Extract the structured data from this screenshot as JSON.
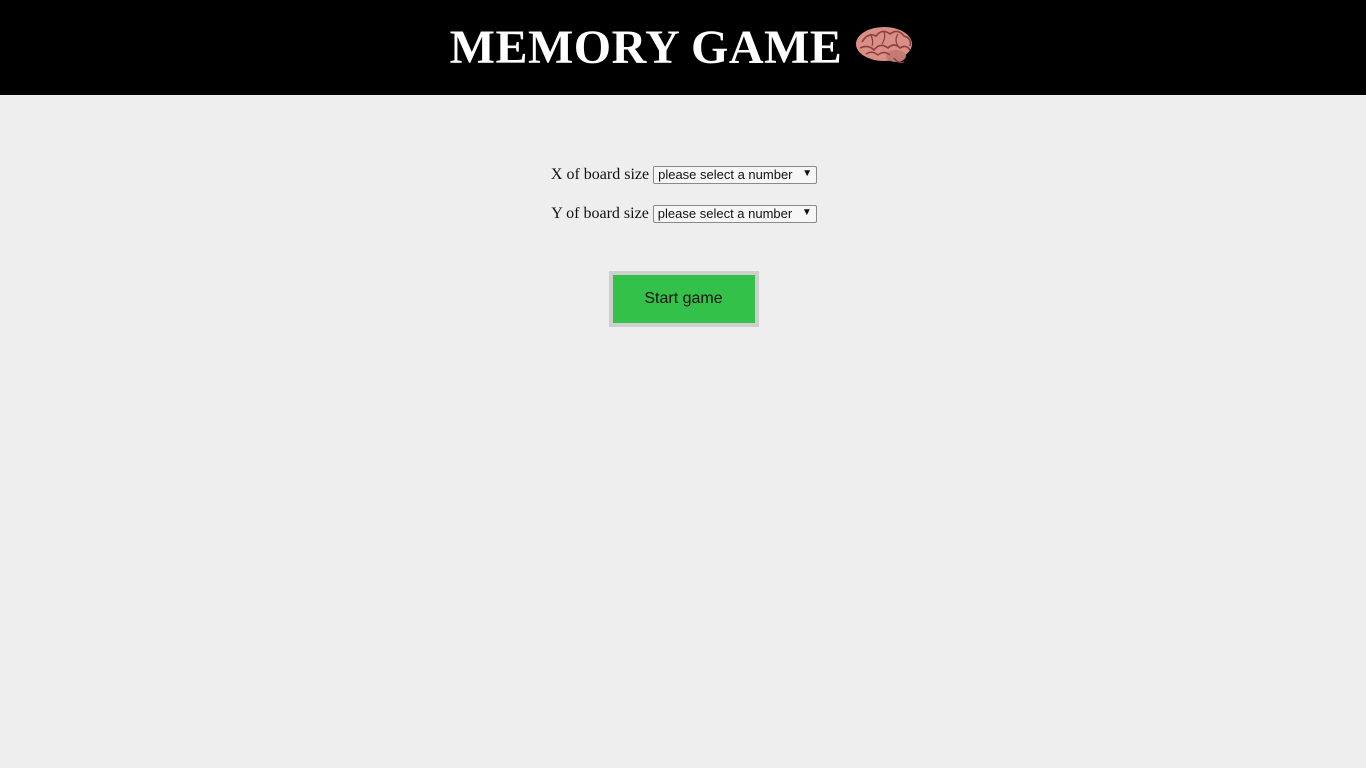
{
  "header": {
    "title": "MEMORY GAME",
    "icon": "brain-icon"
  },
  "form": {
    "x_field": {
      "label": "X of board size",
      "selected": "please select a number"
    },
    "y_field": {
      "label": "Y of board size",
      "selected": "please select a number"
    }
  },
  "actions": {
    "start_label": "Start game"
  },
  "colors": {
    "header_bg": "#000000",
    "page_bg": "#eeeeee",
    "button_bg": "#33c14a",
    "button_border": "#cfcfcf"
  }
}
